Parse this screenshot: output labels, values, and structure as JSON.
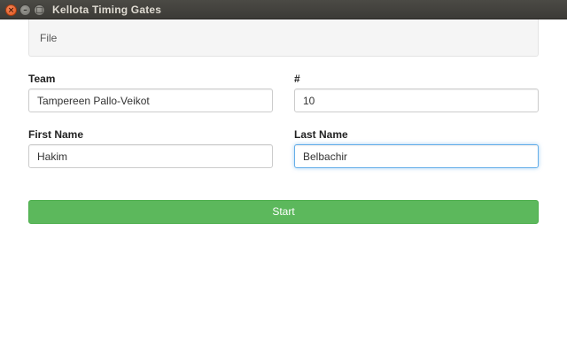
{
  "window": {
    "title": "Kellota Timing Gates",
    "controls": {
      "close": "×",
      "minimize": "–",
      "maximize": "□"
    }
  },
  "file_panel": {
    "label": "File"
  },
  "form": {
    "team": {
      "label": "Team",
      "value": "Tampereen Pallo-Veikot"
    },
    "number": {
      "label": "#",
      "value": "10"
    },
    "first_name": {
      "label": "First Name",
      "value": "Hakim"
    },
    "last_name": {
      "label": "Last Name",
      "value": "Belbachir"
    }
  },
  "actions": {
    "start_label": "Start"
  },
  "colors": {
    "start_button": "#5cb85c",
    "focus_border": "#66afe9",
    "titlebar": "#3c3b37"
  }
}
